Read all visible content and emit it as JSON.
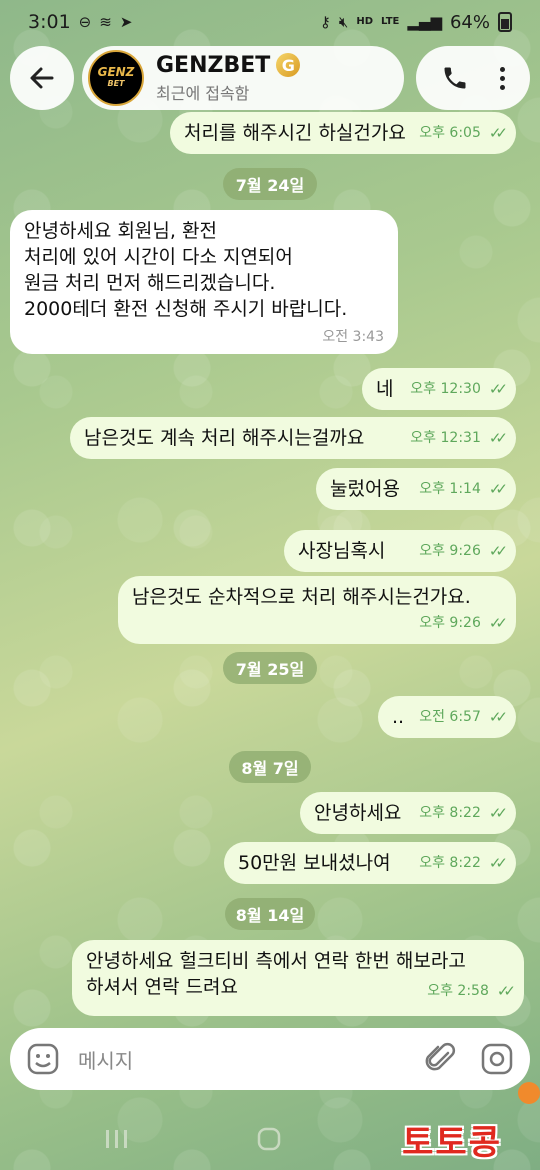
{
  "status_bar": {
    "time": "3:01",
    "battery": "64%",
    "hd_label": "HD",
    "lte_label": "LTE"
  },
  "header": {
    "contact_name": "GENZBET",
    "status": "최근에 접속함",
    "avatar_text": "GENZ",
    "avatar_sub": "BET",
    "badge_letter": "G"
  },
  "messages": [
    {
      "dir": "out",
      "text": "처리를 해주시긴 하실건가요",
      "time": "오후 6:05"
    },
    {
      "dir": "date",
      "text": "7월 24일"
    },
    {
      "dir": "in",
      "text": "안녕하세요 회원님, 환전\n처리에 있어 시간이 다소 지연되어\n원금 처리 먼저 해드리겠습니다.\n2000테더 환전 신청해 주시기 바랍니다.",
      "time": "오전 3:43"
    },
    {
      "dir": "out",
      "text": "네",
      "time": "오후 12:30"
    },
    {
      "dir": "out",
      "text": "남은것도 계속 처리 해주시는걸까요",
      "time": "오후 12:31"
    },
    {
      "dir": "out",
      "text": "눌렀어용",
      "time": "오후 1:14"
    },
    {
      "dir": "out",
      "text": "사장님혹시",
      "time": "오후 9:26"
    },
    {
      "dir": "out",
      "text": "남은것도 순차적으로 처리 해주시는건가요.",
      "time": "오후 9:26"
    },
    {
      "dir": "date",
      "text": "7월 25일"
    },
    {
      "dir": "out",
      "text": "..",
      "time": "오전 6:57"
    },
    {
      "dir": "date",
      "text": "8월 7일"
    },
    {
      "dir": "out",
      "text": "안녕하세요",
      "time": "오후 8:22"
    },
    {
      "dir": "out",
      "text": "50만원 보내셨나여",
      "time": "오후 8:22"
    },
    {
      "dir": "date",
      "text": "8월 14일"
    },
    {
      "dir": "out",
      "text": "안녕하세요 헐크티비 측에서 연락 한번 해보라고\n하셔서 연락 드려요",
      "time": "오후 2:58"
    }
  ],
  "input": {
    "placeholder": "메시지"
  },
  "watermark": "토토콩",
  "colors": {
    "outgoing_bubble": "#f1fbdf",
    "incoming_bubble": "#ffffff",
    "tick_green": "#5fa85c",
    "watermark_red": "#e0291f"
  }
}
